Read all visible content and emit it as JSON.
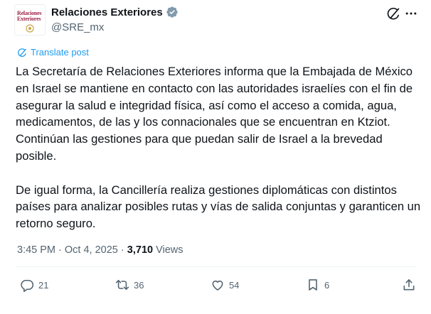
{
  "account": {
    "display_name": "Relaciones Exteriores",
    "handle": "@SRE_mx",
    "avatar_line1": "Relaciones",
    "avatar_line2": "Exteriores"
  },
  "translate_label": "Translate post",
  "post": {
    "paragraph1": "La Secretaría de Relaciones Exteriores informa que la Embajada de México en Israel se mantiene en contacto con las autoridades israelíes con el fin de asegurar la salud e integridad física, así como el acceso a comida, agua, medicamentos, de las y los connacionales que se encuentran en Ktziot. Continúan las gestiones para que puedan salir de Israel a la brevedad posible.",
    "paragraph2": "De igual forma, la Cancillería realiza gestiones diplomáticas con distintos países para analizar posibles rutas y vías de salida conjuntas y garanticen un retorno seguro."
  },
  "meta": {
    "time": "3:45 PM",
    "separator": "·",
    "date": "Oct 4, 2025",
    "views_count": "3,710",
    "views_label": "Views"
  },
  "actions": {
    "replies": "21",
    "reposts": "36",
    "likes": "54",
    "bookmarks": "6"
  },
  "colors": {
    "accent": "#1d9bf0",
    "text": "#0f1419",
    "muted": "#536471",
    "brand": "#9d2449"
  },
  "icons": [
    "verified-badge-icon",
    "grok-icon",
    "more-icon",
    "translate-icon",
    "reply-icon",
    "repost-icon",
    "like-icon",
    "bookmark-icon",
    "share-icon"
  ]
}
